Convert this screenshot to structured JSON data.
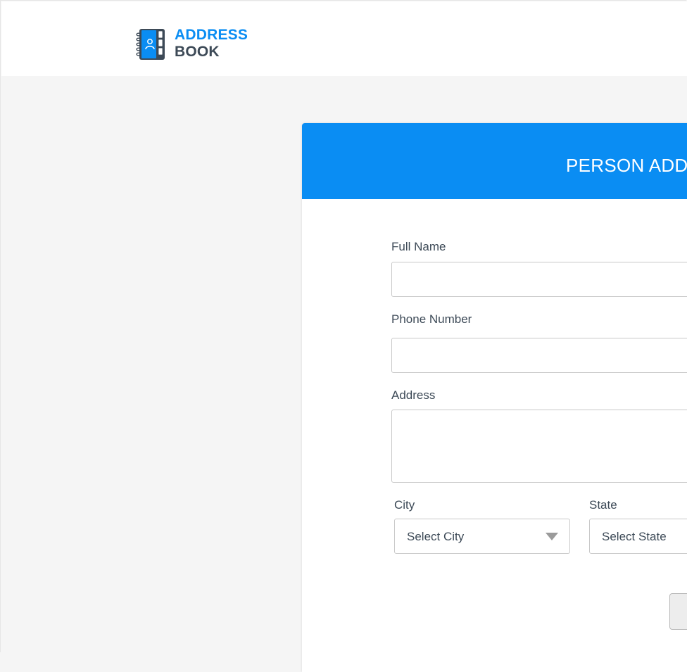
{
  "header": {
    "logo_line1": "ADDRESS",
    "logo_line2": "BOOK",
    "logo_icon": "address-book-icon",
    "colors": {
      "brand_blue": "#0a8df3",
      "brand_dark": "#3d4a57"
    }
  },
  "form": {
    "title": "PERSON ADDR",
    "header_color": "#0a8df3",
    "full_name": {
      "label": "Full Name",
      "value": "",
      "placeholder": ""
    },
    "phone": {
      "label": "Phone Number",
      "value": "",
      "placeholder": ""
    },
    "address": {
      "label": "Address",
      "value": "",
      "placeholder": ""
    },
    "city": {
      "label": "City",
      "selected": "Select City"
    },
    "state": {
      "label": "State",
      "selected": "Select State"
    }
  }
}
